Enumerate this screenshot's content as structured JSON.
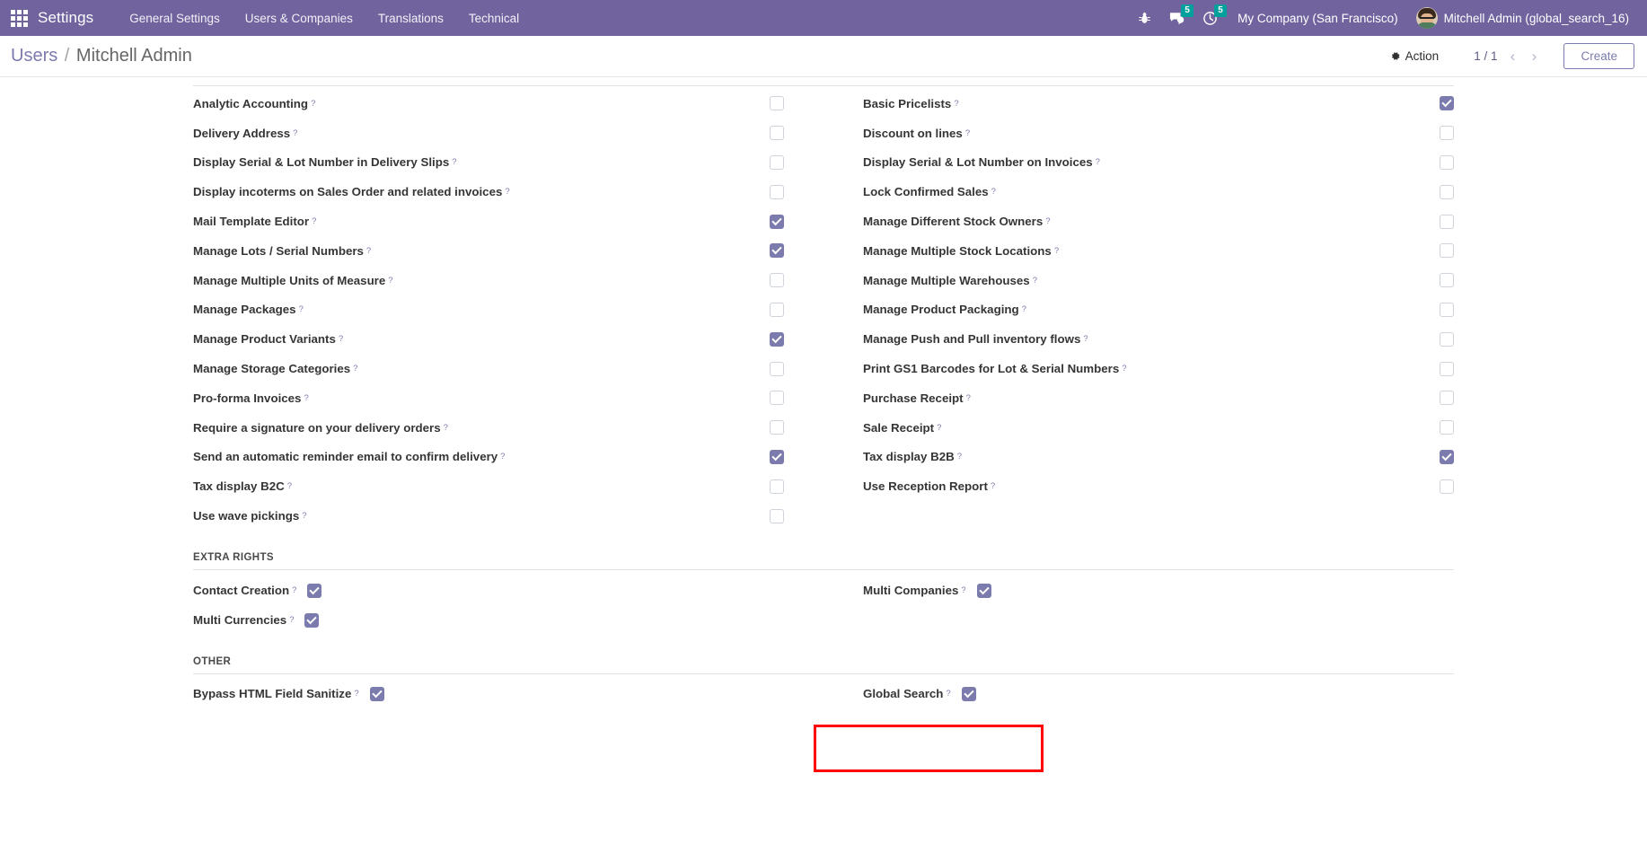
{
  "navbar": {
    "apps_icon": "apps-grid-icon",
    "brand": "Settings",
    "menu": [
      {
        "label": "General Settings"
      },
      {
        "label": "Users & Companies"
      },
      {
        "label": "Translations"
      },
      {
        "label": "Technical"
      }
    ],
    "debug_icon": "bug-icon",
    "messages_icon": "messages-icon",
    "messages_count": "5",
    "activities_icon": "clock-icon",
    "activities_count": "5",
    "company": "My Company (San Francisco)",
    "avatar": "user-avatar",
    "user": "Mitchell Admin (global_search_16)"
  },
  "control_panel": {
    "breadcrumb_root": "Users",
    "breadcrumb_sep": "/",
    "breadcrumb_current": "Mitchell Admin",
    "action_icon": "gear-icon",
    "action_label": "Action",
    "pager_value": "1 / 1",
    "prev_icon": "chevron-left-icon",
    "next_icon": "chevron-right-icon",
    "create_label": "Create"
  },
  "colors": {
    "navbar_bg": "#71639e",
    "accent": "#7c7bad",
    "badge": "#00a09d",
    "highlight": "#ff0000"
  },
  "form": {
    "left_column": [
      {
        "label": "Analytic Accounting",
        "help": "?",
        "checked": false
      },
      {
        "label": "Delivery Address",
        "help": "?",
        "checked": false
      },
      {
        "label": "Display Serial & Lot Number in Delivery Slips",
        "help": "?",
        "checked": false
      },
      {
        "label": "Display incoterms on Sales Order and related invoices",
        "help": "?",
        "checked": false
      },
      {
        "label": "Mail Template Editor",
        "help": "?",
        "checked": true
      },
      {
        "label": "Manage Lots / Serial Numbers",
        "help": "?",
        "checked": true
      },
      {
        "label": "Manage Multiple Units of Measure",
        "help": "?",
        "checked": false
      },
      {
        "label": "Manage Packages",
        "help": "?",
        "checked": false
      },
      {
        "label": "Manage Product Variants",
        "help": "?",
        "checked": true
      },
      {
        "label": "Manage Storage Categories",
        "help": "?",
        "checked": false
      },
      {
        "label": "Pro-forma Invoices",
        "help": "?",
        "checked": false
      },
      {
        "label": "Require a signature on your delivery orders",
        "help": "?",
        "checked": false
      },
      {
        "label": "Send an automatic reminder email to confirm delivery",
        "help": "?",
        "checked": true
      },
      {
        "label": "Tax display B2C",
        "help": "?",
        "checked": false
      },
      {
        "label": "Use wave pickings",
        "help": "?",
        "checked": false
      }
    ],
    "right_column": [
      {
        "label": "Basic Pricelists",
        "help": "?",
        "checked": true
      },
      {
        "label": "Discount on lines",
        "help": "?",
        "checked": false
      },
      {
        "label": "Display Serial & Lot Number on Invoices",
        "help": "?",
        "checked": false
      },
      {
        "label": "Lock Confirmed Sales",
        "help": "?",
        "checked": false
      },
      {
        "label": "Manage Different Stock Owners",
        "help": "?",
        "checked": false
      },
      {
        "label": "Manage Multiple Stock Locations",
        "help": "?",
        "checked": false
      },
      {
        "label": "Manage Multiple Warehouses",
        "help": "?",
        "checked": false
      },
      {
        "label": "Manage Product Packaging",
        "help": "?",
        "checked": false
      },
      {
        "label": "Manage Push and Pull inventory flows",
        "help": "?",
        "checked": false
      },
      {
        "label": "Print GS1 Barcodes for Lot & Serial Numbers",
        "help": "?",
        "checked": false
      },
      {
        "label": "Purchase Receipt",
        "help": "?",
        "checked": false
      },
      {
        "label": "Sale Receipt",
        "help": "?",
        "checked": false
      },
      {
        "label": "Tax display B2B",
        "help": "?",
        "checked": true
      },
      {
        "label": "Use Reception Report",
        "help": "?",
        "checked": false
      }
    ],
    "extra_rights": {
      "title": "EXTRA RIGHTS",
      "left": [
        {
          "label": "Contact Creation",
          "help": "?",
          "checked": true
        },
        {
          "label": "Multi Currencies",
          "help": "?",
          "checked": true
        }
      ],
      "right": [
        {
          "label": "Multi Companies",
          "help": "?",
          "checked": true
        }
      ]
    },
    "other": {
      "title": "OTHER",
      "left": [
        {
          "label": "Bypass HTML Field Sanitize",
          "help": "?",
          "checked": true
        }
      ],
      "right": [
        {
          "label": "Global Search",
          "help": "?",
          "checked": true,
          "highlighted": true
        }
      ]
    }
  }
}
